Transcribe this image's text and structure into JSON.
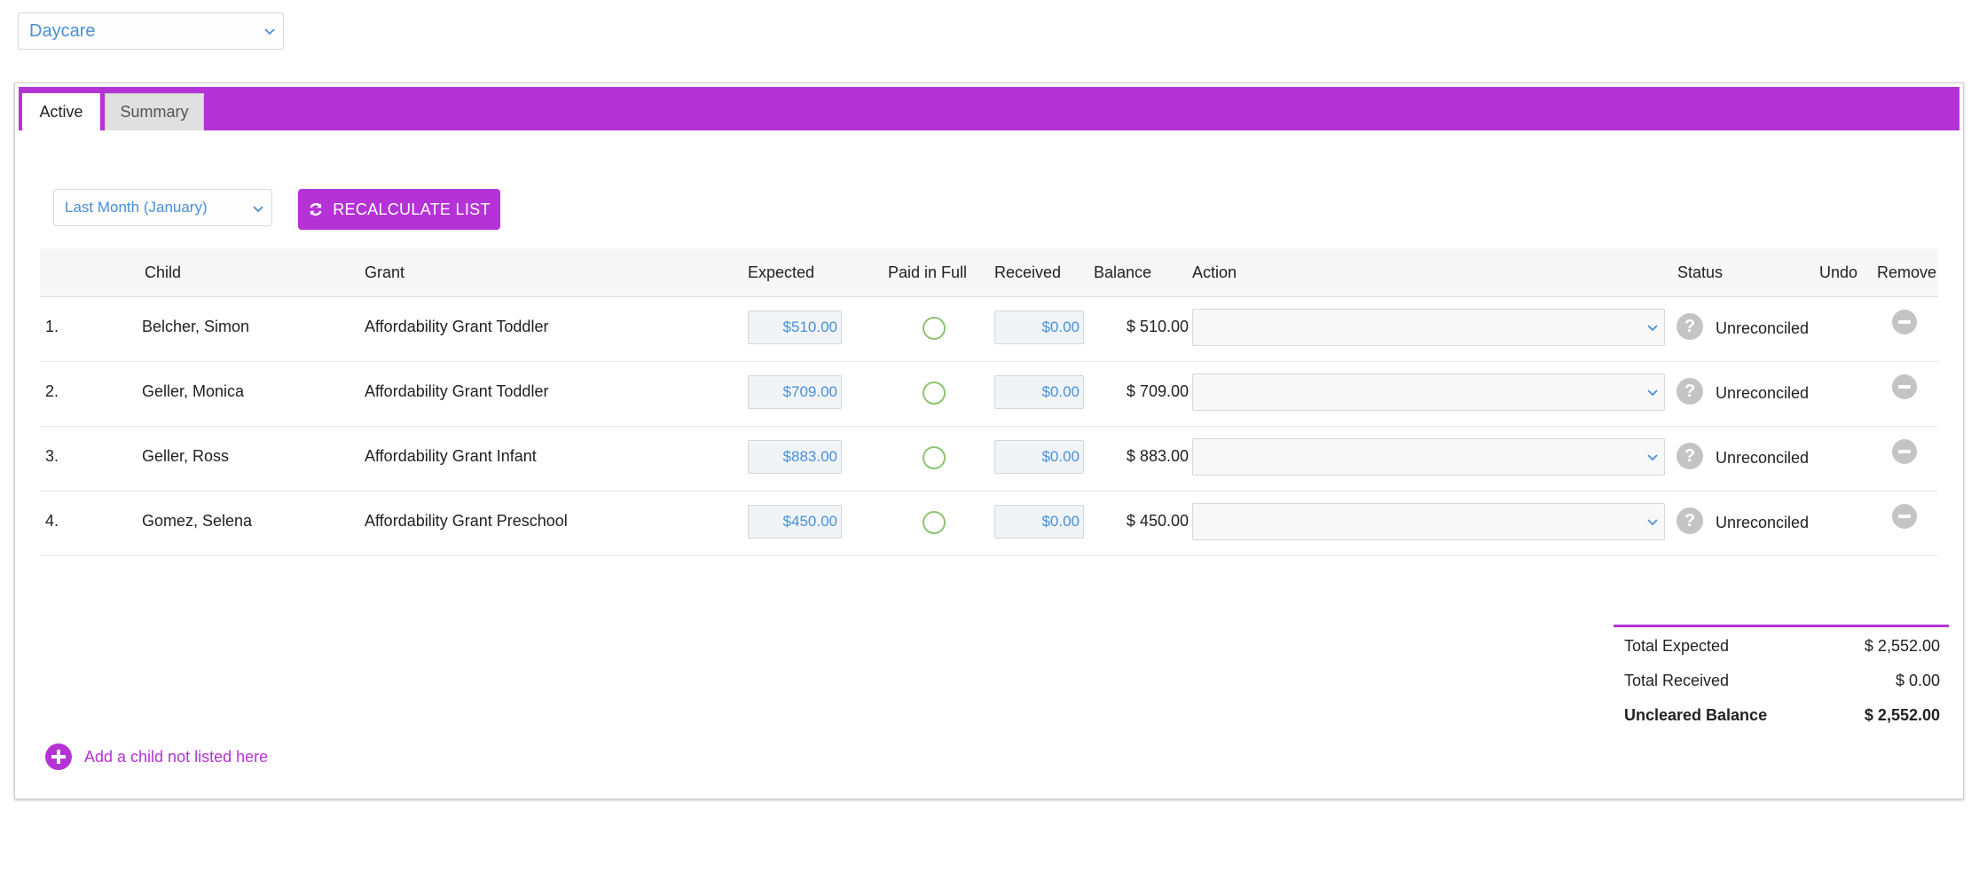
{
  "facility": {
    "selected": "Daycare"
  },
  "tabs": [
    {
      "label": "Active"
    },
    {
      "label": "Summary"
    }
  ],
  "toolbar": {
    "period": "Last Month (January)",
    "recalc_label": "RECALCULATE LIST"
  },
  "table": {
    "headers": {
      "child": "Child",
      "grant": "Grant",
      "expected": "Expected",
      "paid": "Paid in Full",
      "received": "Received",
      "balance": "Balance",
      "action": "Action",
      "status": "Status",
      "undo": "Undo",
      "remove": "Remove"
    },
    "rows": [
      {
        "num": "1.",
        "child": "Belcher, Simon",
        "grant": "Affordability Grant Toddler",
        "expected": "$510.00",
        "received": "$0.00",
        "balance": "$ 510.00",
        "status": "Unreconciled"
      },
      {
        "num": "2.",
        "child": "Geller, Monica",
        "grant": "Affordability Grant Toddler",
        "expected": "$709.00",
        "received": "$0.00",
        "balance": "$ 709.00",
        "status": "Unreconciled"
      },
      {
        "num": "3.",
        "child": "Geller, Ross",
        "grant": "Affordability Grant Infant",
        "expected": "$883.00",
        "received": "$0.00",
        "balance": "$ 883.00",
        "status": "Unreconciled"
      },
      {
        "num": "4.",
        "child": "Gomez, Selena",
        "grant": "Affordability Grant Preschool",
        "expected": "$450.00",
        "received": "$0.00",
        "balance": "$ 450.00",
        "status": "Unreconciled"
      }
    ]
  },
  "totals": {
    "expected_label": "Total Expected",
    "expected_value": "$ 2,552.00",
    "received_label": "Total Received",
    "received_value": "$ 0.00",
    "balance_label": "Uncleared Balance",
    "balance_value": "$ 2,552.00"
  },
  "add_child_label": "Add a child not listed here",
  "colors": {
    "accent": "#b533d6",
    "link": "#4a8fd6",
    "radio": "#8cc56f"
  }
}
